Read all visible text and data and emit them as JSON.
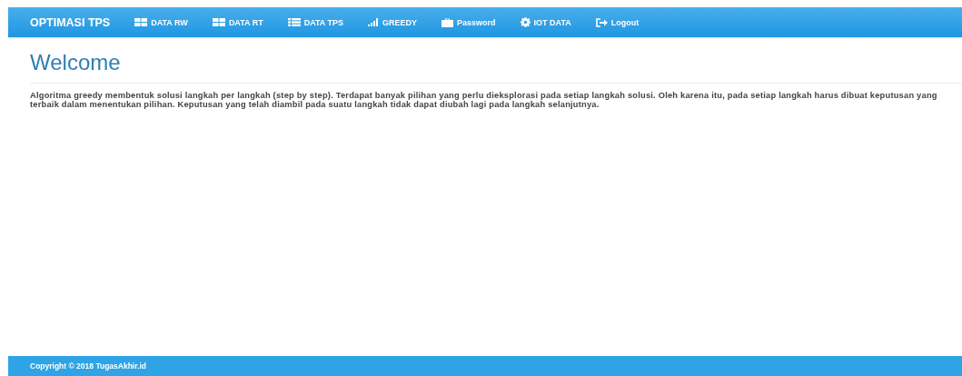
{
  "navbar": {
    "brand": "OPTIMASI TPS",
    "items": [
      {
        "label": "DATA RW",
        "kind": "grid"
      },
      {
        "label": "DATA RT",
        "kind": "grid"
      },
      {
        "label": "DATA TPS",
        "kind": "list"
      },
      {
        "label": "GREEDY",
        "kind": "signal"
      },
      {
        "label": "Password",
        "kind": "briefcase"
      },
      {
        "label": "IOT DATA",
        "kind": "gear"
      },
      {
        "label": "Logout",
        "kind": "logout"
      }
    ]
  },
  "heading": "Welcome",
  "paragraph": [
    "Algoritma greedy membentuk solusi langkah per langkah (step by step). Terdapat banyak pilihan yang perlu dieksplorasi pada setiap langkah solusi. Oleh karena itu, pada setiap langkah harus dibuat keputusan yang",
    "terbaik dalam menentukan pilihan. Keputusan yang telah diambil pada suatu langkah tidak dapat diubah lagi pada langkah selanjutnya."
  ],
  "footer": "Copyright © 2018 TugasAkhir.id"
}
